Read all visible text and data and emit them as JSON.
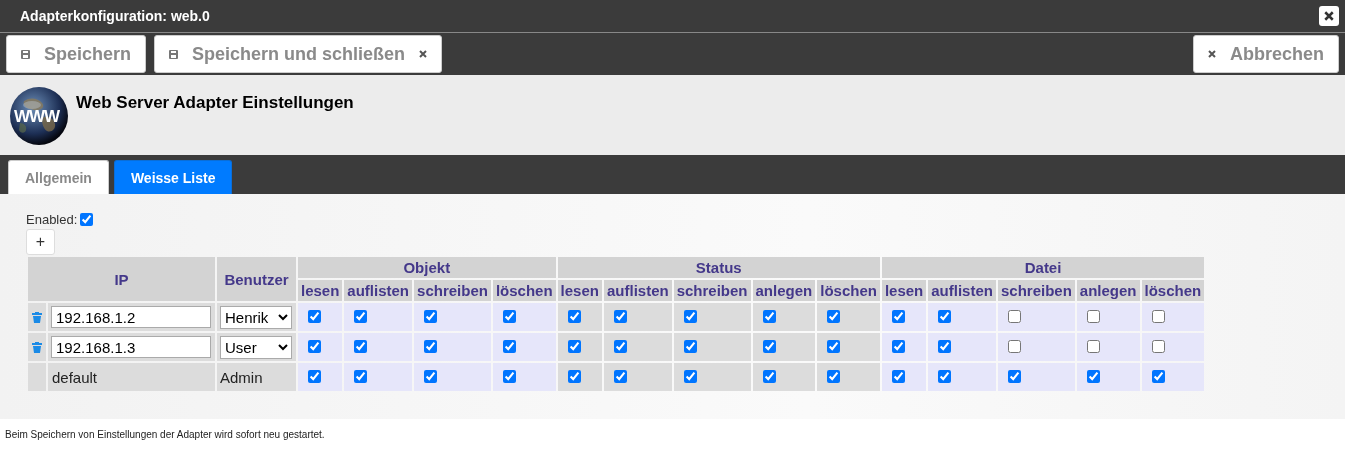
{
  "window": {
    "title": "Adapterkonfiguration: web.0"
  },
  "toolbar": [
    {
      "kind": "save",
      "label": "Speichern"
    },
    {
      "kind": "save-close",
      "label": "Speichern und schließen"
    },
    {
      "kind": "cancel",
      "label": "Abbrechen"
    }
  ],
  "header": {
    "logo_text": "WWW",
    "title": "Web Server Adapter Einstellungen"
  },
  "tabs": [
    {
      "label": "Allgemein",
      "selected": false
    },
    {
      "label": "Weisse Liste",
      "selected": true
    }
  ],
  "enabled": {
    "label": "Enabled:",
    "checked": true
  },
  "add_button": "+",
  "table": {
    "columns": {
      "ip": "IP",
      "user": "Benutzer"
    },
    "groups": [
      {
        "name": "Objekt",
        "permissions": [
          "lesen",
          "auflisten",
          "schreiben",
          "löschen"
        ]
      },
      {
        "name": "Status",
        "permissions": [
          "lesen",
          "auflisten",
          "schreiben",
          "anlegen",
          "löschen"
        ]
      },
      {
        "name": "Datei",
        "permissions": [
          "lesen",
          "auflisten",
          "schreiben",
          "anlegen",
          "löschen"
        ]
      }
    ],
    "rows": [
      {
        "kind": "editable",
        "ip": "192.168.1.2",
        "user": "Henrik",
        "checks": [
          true,
          true,
          true,
          true,
          true,
          true,
          true,
          true,
          true,
          true,
          true,
          false,
          false,
          false
        ]
      },
      {
        "kind": "editable",
        "ip": "192.168.1.3",
        "user": "User",
        "checks": [
          true,
          true,
          true,
          true,
          true,
          true,
          true,
          true,
          true,
          true,
          true,
          false,
          false,
          false
        ]
      },
      {
        "kind": "fixed",
        "ip": "default",
        "user": "Admin",
        "checks": [
          true,
          true,
          true,
          true,
          true,
          true,
          true,
          true,
          true,
          true,
          true,
          true,
          true,
          true
        ]
      }
    ]
  },
  "footer_note": "Beim Speichern von Einstellungen der Adapter wird sofort neu gestartet."
}
